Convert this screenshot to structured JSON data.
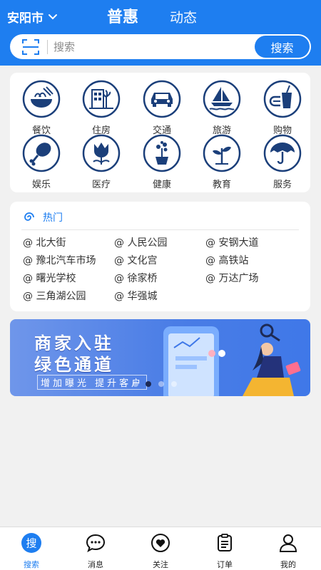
{
  "header": {
    "city": "安阳市",
    "tab_active": "普惠",
    "tab_inactive": "动态"
  },
  "search": {
    "placeholder": "搜索",
    "value": "",
    "button_label": "搜索"
  },
  "categories": [
    {
      "label": "餐饮",
      "icon": "noodle-bowl-icon"
    },
    {
      "label": "住房",
      "icon": "building-icon"
    },
    {
      "label": "交通",
      "icon": "car-icon"
    },
    {
      "label": "旅游",
      "icon": "sailboat-icon"
    },
    {
      "label": "购物",
      "icon": "shopping-cup-icon"
    },
    {
      "label": "娱乐",
      "icon": "drumstick-icon"
    },
    {
      "label": "医疗",
      "icon": "tulip-icon"
    },
    {
      "label": "健康",
      "icon": "potted-plant-icon"
    },
    {
      "label": "教育",
      "icon": "sprout-icon"
    },
    {
      "label": "服务",
      "icon": "umbrella-icon"
    }
  ],
  "hot": {
    "title": "热门",
    "items": [
      "@ 北大街",
      "@ 人民公园",
      "@ 安钢大道",
      "@ 豫北汽车市场",
      "@ 文化宫",
      "@ 高铁站",
      "@ 曙光学校",
      "@ 徐家桥",
      "@ 万达广场",
      "@ 三角湖公园",
      "@ 华强城"
    ]
  },
  "banner": {
    "line1": "商家入驻",
    "line2": "绿色通道",
    "line3": "增加曝光 提升客户",
    "active_slide": 2,
    "slide_count": 4
  },
  "tabbar": [
    {
      "label": "搜索",
      "icon": "search-char-icon",
      "glyph": "搜",
      "active": true
    },
    {
      "label": "消息",
      "icon": "message-icon",
      "active": false
    },
    {
      "label": "关注",
      "icon": "heart-icon",
      "active": false
    },
    {
      "label": "订单",
      "icon": "order-icon",
      "active": false
    },
    {
      "label": "我的",
      "icon": "profile-icon",
      "active": false
    }
  ],
  "colors": {
    "primary": "#1e7ef0",
    "icon_navy": "#1b3f7a",
    "background": "#f1f1f1"
  }
}
